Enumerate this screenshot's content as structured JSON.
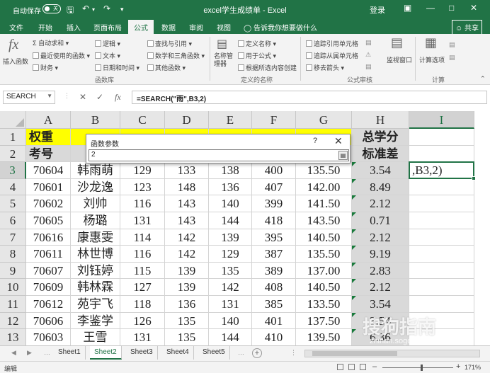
{
  "titlebar": {
    "autosave_label": "自动保存",
    "autosave_state": "关",
    "title": "excel学生成绩单 - Excel",
    "login": "登录"
  },
  "tabs": [
    "文件",
    "开始",
    "插入",
    "页面布局",
    "公式",
    "数据",
    "审阅",
    "视图"
  ],
  "active_tab": "公式",
  "tell_me": "告诉我你想要做什么",
  "share": "共享",
  "ribbon": {
    "insert_function": "插入函数",
    "autosum": "自动求和",
    "recent": "最近使用的函数",
    "financial": "财务",
    "logical": "逻辑",
    "text": "文本",
    "datetime": "日期和时间",
    "lookup": "查找与引用",
    "math": "数学和三角函数",
    "more": "其他函数",
    "library_group": "函数库",
    "name_manager": "名称管理器",
    "define_name": "定义名称",
    "use_in_formula": "用于公式",
    "create_from_selection": "根据所选内容创建",
    "names_group": "定义的名称",
    "trace_precedents": "追踪引用单元格",
    "trace_dependents": "追踪从属单元格",
    "remove_arrows": "移去箭头",
    "audit_group": "公式审核",
    "watch_window": "监视窗口",
    "calc_options": "计算选项",
    "calc_group": "计算"
  },
  "formula_bar": {
    "name_box": "SEARCH",
    "formula": "=SEARCH(\"雨\",B3,2)"
  },
  "columns": [
    "A",
    "B",
    "C",
    "D",
    "E",
    "F",
    "G",
    "H",
    "I"
  ],
  "selected_column": "I",
  "selected_row": "3",
  "rows": [
    {
      "num": "1",
      "cells": [
        "权重",
        "",
        "",
        "",
        "",
        "",
        "",
        "总学分",
        ""
      ]
    },
    {
      "num": "2",
      "cells": [
        "考号",
        "",
        "",
        "",
        "",
        "",
        "",
        "标准差",
        ""
      ]
    },
    {
      "num": "3",
      "cells": [
        "70604",
        "韩雨萌",
        "129",
        "133",
        "138",
        "400",
        "135.50",
        "3.54",
        ",B3,2)"
      ]
    },
    {
      "num": "4",
      "cells": [
        "70601",
        "沙龙逸",
        "123",
        "148",
        "136",
        "407",
        "142.00",
        "8.49",
        ""
      ]
    },
    {
      "num": "5",
      "cells": [
        "70602",
        "刘帅",
        "116",
        "143",
        "140",
        "399",
        "141.50",
        "2.12",
        ""
      ]
    },
    {
      "num": "6",
      "cells": [
        "70605",
        "杨璐",
        "131",
        "143",
        "144",
        "418",
        "143.50",
        "0.71",
        ""
      ]
    },
    {
      "num": "7",
      "cells": [
        "70616",
        "康惠雯",
        "114",
        "142",
        "139",
        "395",
        "140.50",
        "2.12",
        ""
      ]
    },
    {
      "num": "8",
      "cells": [
        "70611",
        "林世博",
        "116",
        "142",
        "129",
        "387",
        "135.50",
        "9.19",
        ""
      ]
    },
    {
      "num": "9",
      "cells": [
        "70607",
        "刘钰婷",
        "115",
        "139",
        "135",
        "389",
        "137.00",
        "2.83",
        ""
      ]
    },
    {
      "num": "10",
      "cells": [
        "70609",
        "韩林霖",
        "127",
        "139",
        "142",
        "408",
        "140.50",
        "2.12",
        ""
      ]
    },
    {
      "num": "11",
      "cells": [
        "70612",
        "苑宇飞",
        "118",
        "136",
        "131",
        "385",
        "133.50",
        "3.54",
        ""
      ]
    },
    {
      "num": "12",
      "cells": [
        "70606",
        "李鉴学",
        "126",
        "135",
        "140",
        "401",
        "137.50",
        "3.54",
        ""
      ]
    },
    {
      "num": "13",
      "cells": [
        "70603",
        "王雪",
        "131",
        "135",
        "144",
        "410",
        "139.50",
        "6.36",
        ""
      ]
    }
  ],
  "dialog": {
    "title": "函数参数",
    "help": "?",
    "input_value": "2"
  },
  "sheets": [
    "Sheet1",
    "Sheet2",
    "Sheet3",
    "Sheet4",
    "Sheet5"
  ],
  "active_sheet": "Sheet2",
  "status": {
    "mode": "编辑",
    "zoom": "171%"
  },
  "watermark": {
    "main": "搜狗指南",
    "sub": "zhinan.sogou.com"
  }
}
